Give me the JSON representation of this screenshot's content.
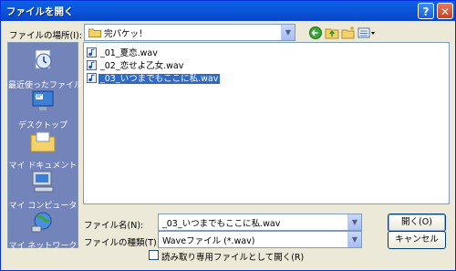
{
  "window": {
    "title": "ファイルを開く",
    "help_glyph": "?",
    "close_glyph": "✕"
  },
  "lookin": {
    "label": "ファイルの場所(I):",
    "value": "完パケッ！"
  },
  "places": [
    {
      "label": "最近使ったファイル",
      "icon": "recent-documents-icon"
    },
    {
      "label": "デスクトップ",
      "icon": "desktop-icon"
    },
    {
      "label": "マイ ドキュメント",
      "icon": "my-documents-icon"
    },
    {
      "label": "マイ コンピュータ",
      "icon": "my-computer-icon"
    },
    {
      "label": "マイ ネットワーク",
      "icon": "my-network-icon"
    }
  ],
  "files": [
    {
      "name": "_01_夏恋.wav",
      "selected": false
    },
    {
      "name": "_02_恋せよ乙女.wav",
      "selected": false
    },
    {
      "name": "_03_いつまでもここに私.wav",
      "selected": true
    }
  ],
  "filename": {
    "label": "ファイル名(N):",
    "value": "_03_いつまでもここに私.wav"
  },
  "filetype": {
    "label": "ファイルの種類(T):",
    "value": "Waveファイル (*.wav)"
  },
  "readonly": {
    "label": "読み取り専用ファイルとして開く(R)",
    "checked": false
  },
  "buttons": {
    "open": "開く(O)",
    "cancel": "キャンセル"
  },
  "colors": {
    "title_bar": "#0b52d6",
    "places_bg": "#7384bb",
    "selection": "#316ac5"
  }
}
